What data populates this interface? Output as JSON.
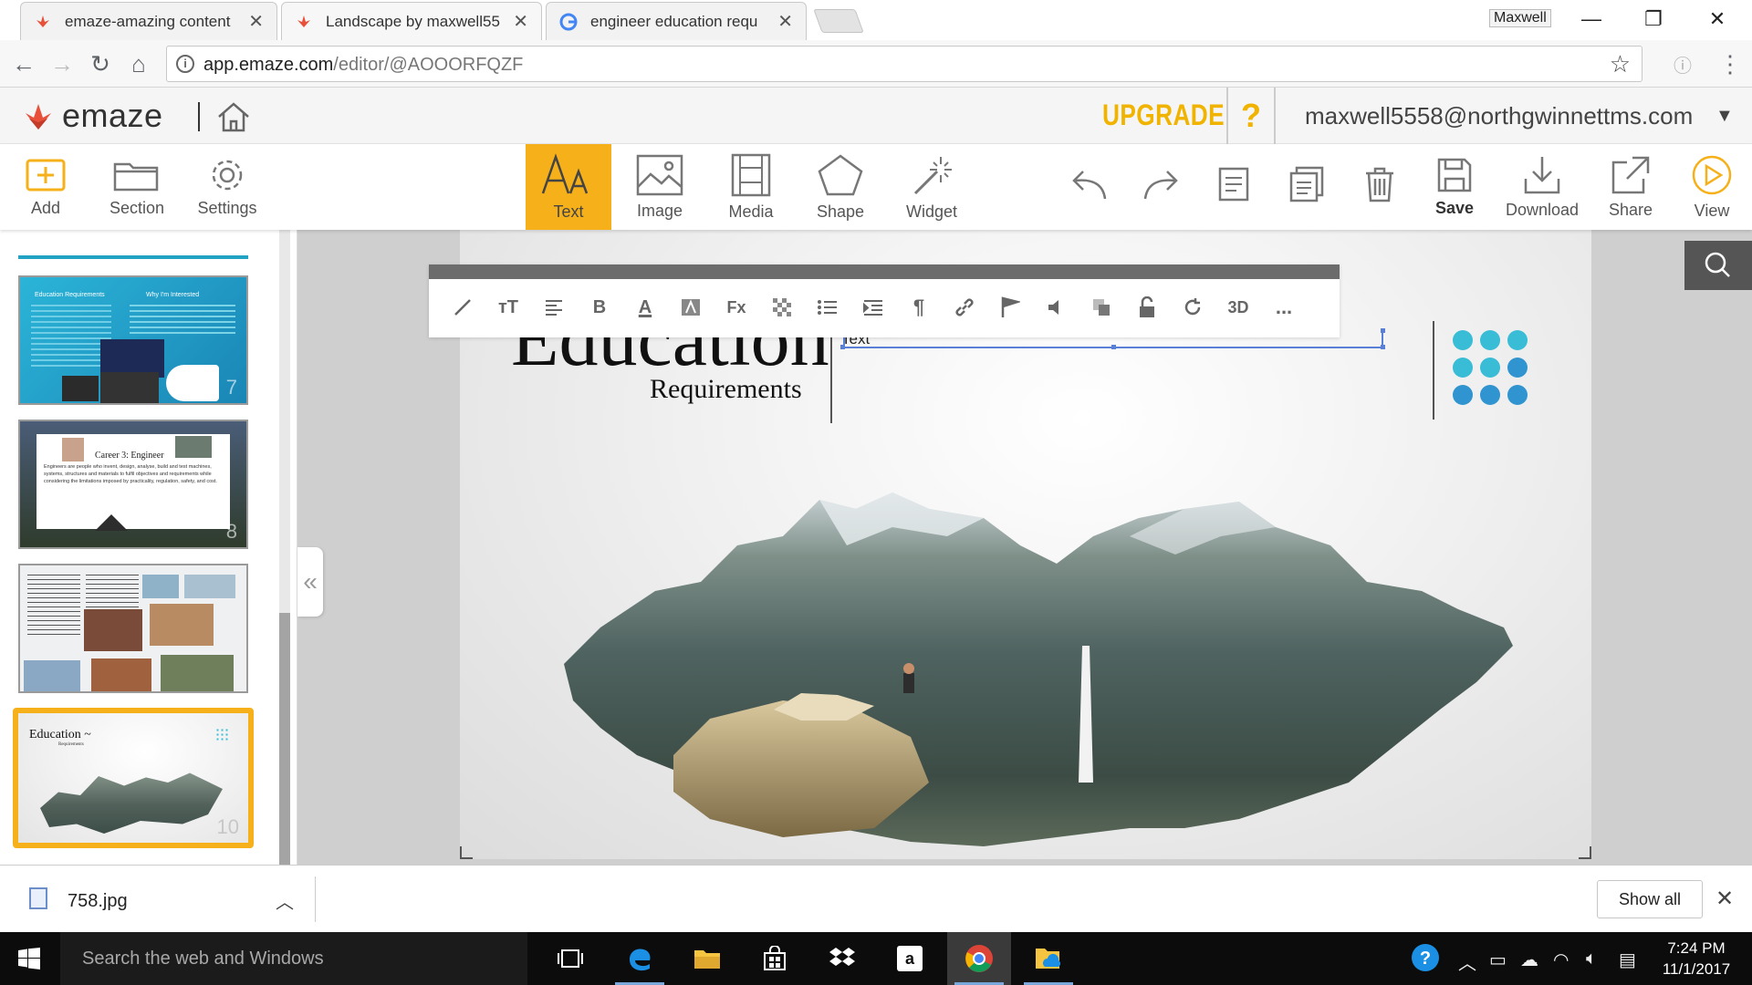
{
  "browser": {
    "tabs": [
      {
        "title": "emaze-amazing content",
        "active": false
      },
      {
        "title": "Landscape by maxwell55",
        "active": true
      },
      {
        "title": "engineer education requ",
        "active": false
      }
    ],
    "profile_name": "Maxwell",
    "url_host": "app.emaze.com",
    "url_path": "/editor/@AOOORFQZF"
  },
  "app_header": {
    "logo_text": "emaze",
    "upgrade_label": "UPGRADE",
    "help_label": "?",
    "user_email": "maxwell5558@northgwinnettms.com",
    "accent_color": "#f5b01a"
  },
  "toolbar": {
    "left": [
      {
        "label": "Add",
        "icon": "add-icon"
      },
      {
        "label": "Section",
        "icon": "folder-icon"
      },
      {
        "label": "Settings",
        "icon": "gear-icon"
      }
    ],
    "center": [
      {
        "label": "Text",
        "icon": "text-icon",
        "active": true
      },
      {
        "label": "Image",
        "icon": "image-icon"
      },
      {
        "label": "Media",
        "icon": "film-icon"
      },
      {
        "label": "Shape",
        "icon": "pentagon-icon"
      },
      {
        "label": "Widget",
        "icon": "magic-wand-icon"
      }
    ],
    "right": [
      {
        "label": "Save",
        "icon": "save-icon"
      },
      {
        "label": "Download",
        "icon": "download-icon"
      },
      {
        "label": "Share",
        "icon": "share-icon"
      },
      {
        "label": "View",
        "icon": "play-icon"
      }
    ]
  },
  "text_format_toolbar": {
    "buttons": [
      "brush-icon",
      "font-size-icon",
      "align-icon",
      "bold-icon",
      "font-color-icon",
      "text-bg-icon",
      "clear-format-icon",
      "opacity-icon",
      "list-icon",
      "indent-icon",
      "paragraph-icon",
      "link-icon",
      "flag-icon",
      "sound-icon",
      "layer-icon",
      "lock-icon",
      "rotate-icon",
      "3d-icon",
      "more-icon"
    ],
    "bold_label": "B",
    "color_label": "A",
    "threed_label": "3D",
    "more_label": "..."
  },
  "slides": [
    {
      "number": "7",
      "title": "Education Requirements",
      "right_title": "Why I'm Interested"
    },
    {
      "number": "8",
      "title": "Career 3: Engineer",
      "body": "Engineers are people who invent, design, analyse, build and test machines, systems, structures and materials to fulfil objectives and requirements while considering the limitations imposed by practicality, regulation, safety, and cost."
    },
    {
      "number": "",
      "title": ""
    },
    {
      "number": "10",
      "title": "Education ~",
      "subtitle": "Requirements",
      "selected": true
    }
  ],
  "canvas": {
    "heading": "Education",
    "subheading": "Requirements",
    "textbox_value": "Text",
    "dot_colors": [
      "#39bcd6",
      "#39bcd6",
      "#39bcd6",
      "#39bcd6",
      "#39bcd6",
      "#2f94cf",
      "#2f94cf",
      "#2f94cf",
      "#2f94cf"
    ]
  },
  "download_shelf": {
    "file_name": "758.jpg",
    "show_all_label": "Show all"
  },
  "taskbar": {
    "search_placeholder": "Search the web and Windows",
    "time": "7:24 PM",
    "date": "11/1/2017"
  }
}
